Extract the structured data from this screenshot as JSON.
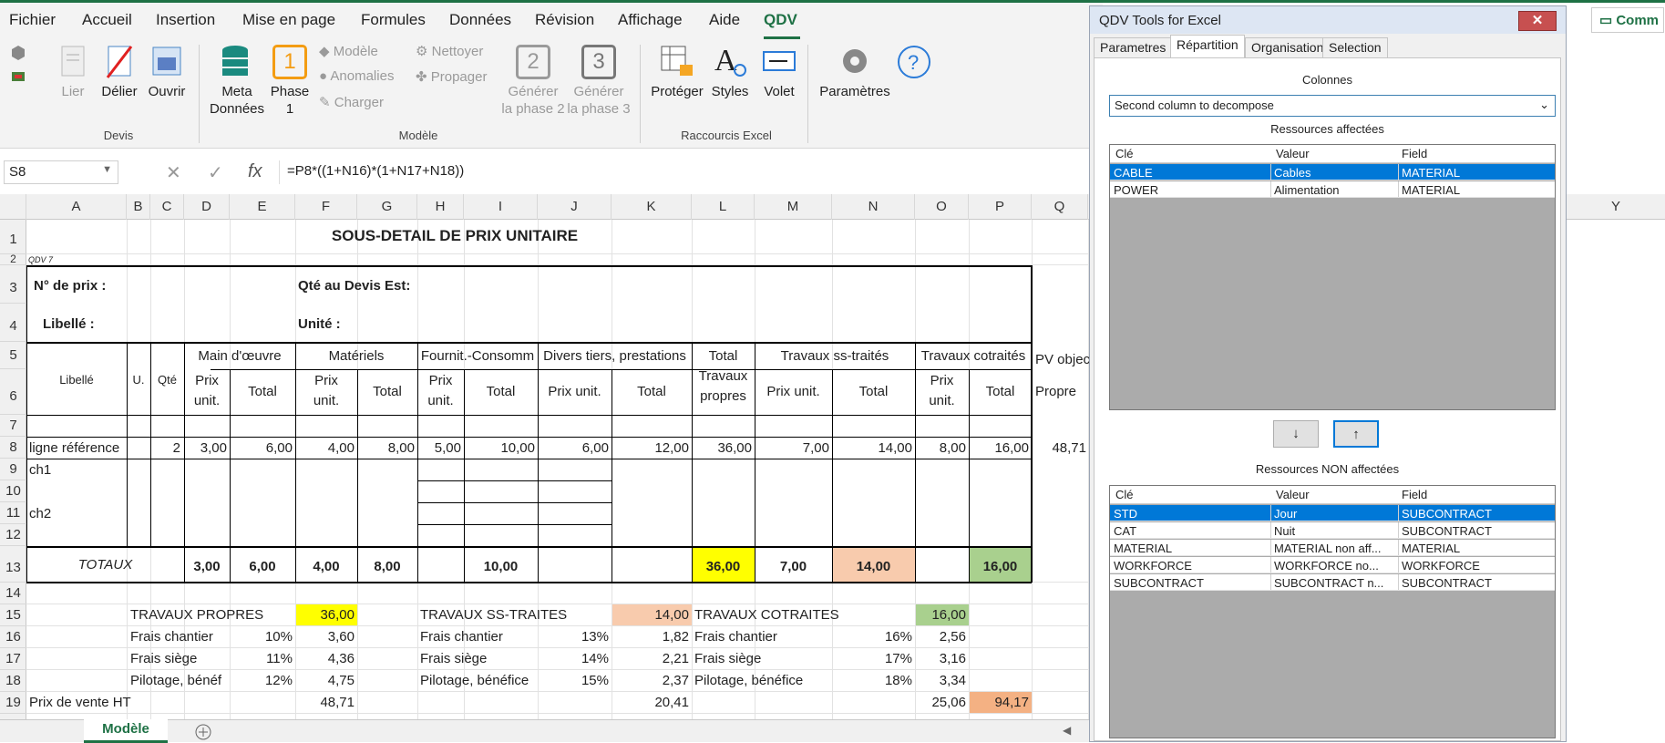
{
  "menu": {
    "items": [
      "Fichier",
      "Accueil",
      "Insertion",
      "Mise en page",
      "Formules",
      "Données",
      "Révision",
      "Affichage",
      "Aide",
      "QDV"
    ],
    "active": "QDV"
  },
  "ribbon": {
    "lier": "Lier",
    "delier": "Délier",
    "ouvrir": "Ouvrir",
    "group_devis": "Devis",
    "meta_l1": "Meta",
    "meta_l2": "Données",
    "phase_num": "1",
    "phase_l1": "Phase",
    "phase_l2": "1",
    "modele": "Modèle",
    "anomalies": "Anomalies",
    "charger": "Charger",
    "nettoyer": "Nettoyer",
    "propager": "Propager",
    "gen2_num": "2",
    "gen2_l1": "Générer",
    "gen2_l2": "la phase 2",
    "gen3_num": "3",
    "gen3_l1": "Générer",
    "gen3_l2": "la phase 3",
    "group_modele": "Modèle",
    "proteger": "Protéger",
    "styles": "Styles",
    "volet": "Volet",
    "group_raccourcis": "Raccourcis Excel",
    "parametres": "Paramètres"
  },
  "formula_bar": {
    "name_box": "S8",
    "cancel": "✕",
    "confirm": "✓",
    "fx": "fx",
    "formula": "=P8*((1+N16)*(1+N17+N18))"
  },
  "columns": [
    "A",
    "B",
    "C",
    "D",
    "E",
    "F",
    "G",
    "H",
    "I",
    "J",
    "K",
    "L",
    "M",
    "N",
    "O",
    "P",
    "Q",
    "Y"
  ],
  "rows": [
    "1",
    "2",
    "3",
    "4",
    "5",
    "6",
    "7",
    "8",
    "9",
    "10",
    "11",
    "12",
    "13",
    "14",
    "15",
    "16",
    "17",
    "18",
    "19"
  ],
  "sheet": {
    "title": "SOUS-DETAIL DE PRIX UNITAIRE",
    "qdv_tag": "QDV 7",
    "no_prix": "N° de prix :",
    "qte_devis": "Qté au Devis Est:",
    "libelle_label": "Libellé :",
    "unite": "Unité :",
    "hdr_libelle": "Libellé",
    "hdr_u": "U.",
    "hdr_qte": "Qté",
    "hdr_main": "Main d'œuvre",
    "hdr_materiels": "Matériels",
    "hdr_fournit": "Fournit.-Consomm",
    "hdr_divers": "Divers tiers, prestations",
    "hdr_total_travaux_l1": "Total",
    "hdr_total_travaux_l2": "Travaux",
    "hdr_total_travaux_l3": "propres",
    "hdr_ss_traites": "Travaux ss-traités",
    "hdr_cotraites": "Travaux cotraités",
    "hdr_pv_obj": "PV objec",
    "hdr_propre": "Propre",
    "prix_l1": "Prix",
    "prix_l2": "unit.",
    "prix_unit": "Prix unit.",
    "total": "Total",
    "row8": {
      "label": "ligne référence",
      "qte": "2",
      "d": "3,00",
      "e": "6,00",
      "f": "4,00",
      "g": "8,00",
      "h": "5,00",
      "i": "10,00",
      "j": "6,00",
      "k": "12,00",
      "l": "36,00",
      "m": "7,00",
      "n": "14,00",
      "o": "8,00",
      "p": "16,00",
      "q": "48,71"
    },
    "ch1": "ch1",
    "ch2": "ch2",
    "totaux": {
      "label": "TOTAUX",
      "d": "3,00",
      "e": "6,00",
      "f": "4,00",
      "g": "8,00",
      "i": "10,00",
      "l": "36,00",
      "m": "7,00",
      "n": "14,00",
      "p": "16,00"
    },
    "tp_label": "TRAVAUX PROPRES",
    "tp_value": "36,00",
    "tst_label": "TRAVAUX SS-TRAITES",
    "tst_value": "14,00",
    "tc_label": "TRAVAUX COTRAITES",
    "tc_value": "16,00",
    "frais_chantier": "Frais chantier",
    "frais_siege": "Frais siège",
    "pilotage_short": "Pilotage, bénéf",
    "pilotage": "Pilotage, bénéfice",
    "tp_fc_pct": "10%",
    "tp_fc": "3,60",
    "tp_fs_pct": "11%",
    "tp_fs": "4,36",
    "tp_pb_pct": "12%",
    "tp_pb": "4,75",
    "st_fc_pct": "13%",
    "st_fc": "1,82",
    "st_fs_pct": "14%",
    "st_fs": "2,21",
    "st_pb_pct": "15%",
    "st_pb": "2,37",
    "co_fc_pct": "16%",
    "co_fc": "2,56",
    "co_fs_pct": "17%",
    "co_fs": "3,16",
    "co_pb_pct": "18%",
    "co_pb": "3,34",
    "pv_label": "Prix de vente HT",
    "pv_tp": "48,71",
    "pv_st": "20,41",
    "pv_co": "25,06",
    "pv_total": "94,17"
  },
  "sheet_tab": "Modèle",
  "colors": {
    "yellow": "#ffff00",
    "salmon": "#f8cbad",
    "green": "#a9d08e",
    "orange": "#f4b183",
    "accent": "#1e7145"
  },
  "panel": {
    "title": "QDV Tools for Excel",
    "close": "✕",
    "tabs": [
      "Parametres",
      "Répartition",
      "Organisation",
      "Selection"
    ],
    "active_tab": "Répartition",
    "colonnes_label": "Colonnes",
    "select_value": "Second column to decompose",
    "affectees_label": "Ressources affectées",
    "non_affectees_label": "Ressources NON affectées",
    "col_cle": "Clé",
    "col_valeur": "Valeur",
    "col_field": "Field",
    "affectees": [
      {
        "cle": "CABLE",
        "valeur": "Cables",
        "field": "MATERIAL"
      },
      {
        "cle": "POWER",
        "valeur": "Alimentation",
        "field": "MATERIAL"
      }
    ],
    "non_affectees": [
      {
        "cle": "STD",
        "valeur": "Jour",
        "field": "SUBCONTRACT"
      },
      {
        "cle": "CAT",
        "valeur": "Nuit",
        "field": "SUBCONTRACT"
      },
      {
        "cle": "MATERIAL",
        "valeur": "MATERIAL non aff...",
        "field": "MATERIAL"
      },
      {
        "cle": "WORKFORCE",
        "valeur": "WORKFORCE no...",
        "field": "WORKFORCE"
      },
      {
        "cle": "SUBCONTRACT",
        "valeur": "SUBCONTRACT n...",
        "field": "SUBCONTRACT"
      }
    ],
    "btn_down": "↓",
    "btn_up": "↑"
  },
  "comments_button": "Comm"
}
